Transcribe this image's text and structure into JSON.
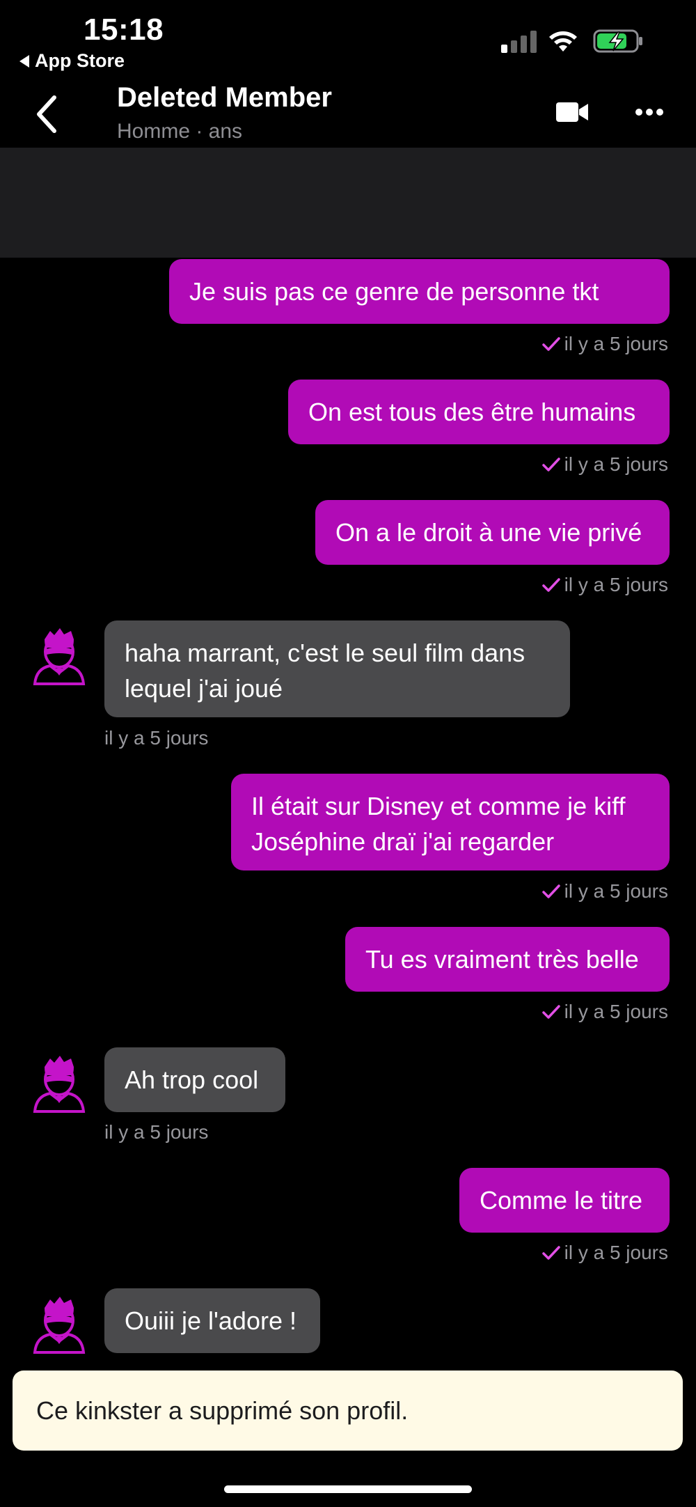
{
  "status_bar": {
    "time": "15:18",
    "back_app": "App Store"
  },
  "header": {
    "title": "Deleted Member",
    "subtitle": "Homme · ans"
  },
  "colors": {
    "sent_bubble": "#b10bb6",
    "received_bubble": "#4a4a4c",
    "check": "#e24fe6",
    "notice_bg": "#fffae6"
  },
  "icons": [
    "back-chevron-icon",
    "video-camera-icon",
    "more-dots-icon",
    "check-icon",
    "avatar-icon",
    "signal-icon",
    "wifi-icon",
    "battery-charging-icon"
  ],
  "messages": [
    {
      "type": "sent",
      "text": "Je suis pas ce genre de personne tkt",
      "time": "il y a 5 jours"
    },
    {
      "type": "sent",
      "text": "On est tous des être humains",
      "time": "il y a 5 jours"
    },
    {
      "type": "sent",
      "text": "On a le droit à une vie privé",
      "time": "il y a 5 jours"
    },
    {
      "type": "received",
      "text": "haha marrant, c'est le seul film dans lequel j'ai joué",
      "time": "il y a 5 jours"
    },
    {
      "type": "sent",
      "text": "Il était sur Disney et comme je kiff Joséphine draï j'ai regarder",
      "time": "il y a 5 jours"
    },
    {
      "type": "sent",
      "text": "Tu es vraiment très belle",
      "time": "il y a 5 jours"
    },
    {
      "type": "received",
      "text": "Ah trop cool",
      "time": "il y a 5 jours"
    },
    {
      "type": "sent",
      "text": "Comme le titre",
      "time": "il y a 5 jours"
    },
    {
      "type": "received",
      "text": "Ouiii je l'adore !",
      "time": ""
    }
  ],
  "notice": {
    "text": "Ce kinkster a supprimé son profil."
  }
}
